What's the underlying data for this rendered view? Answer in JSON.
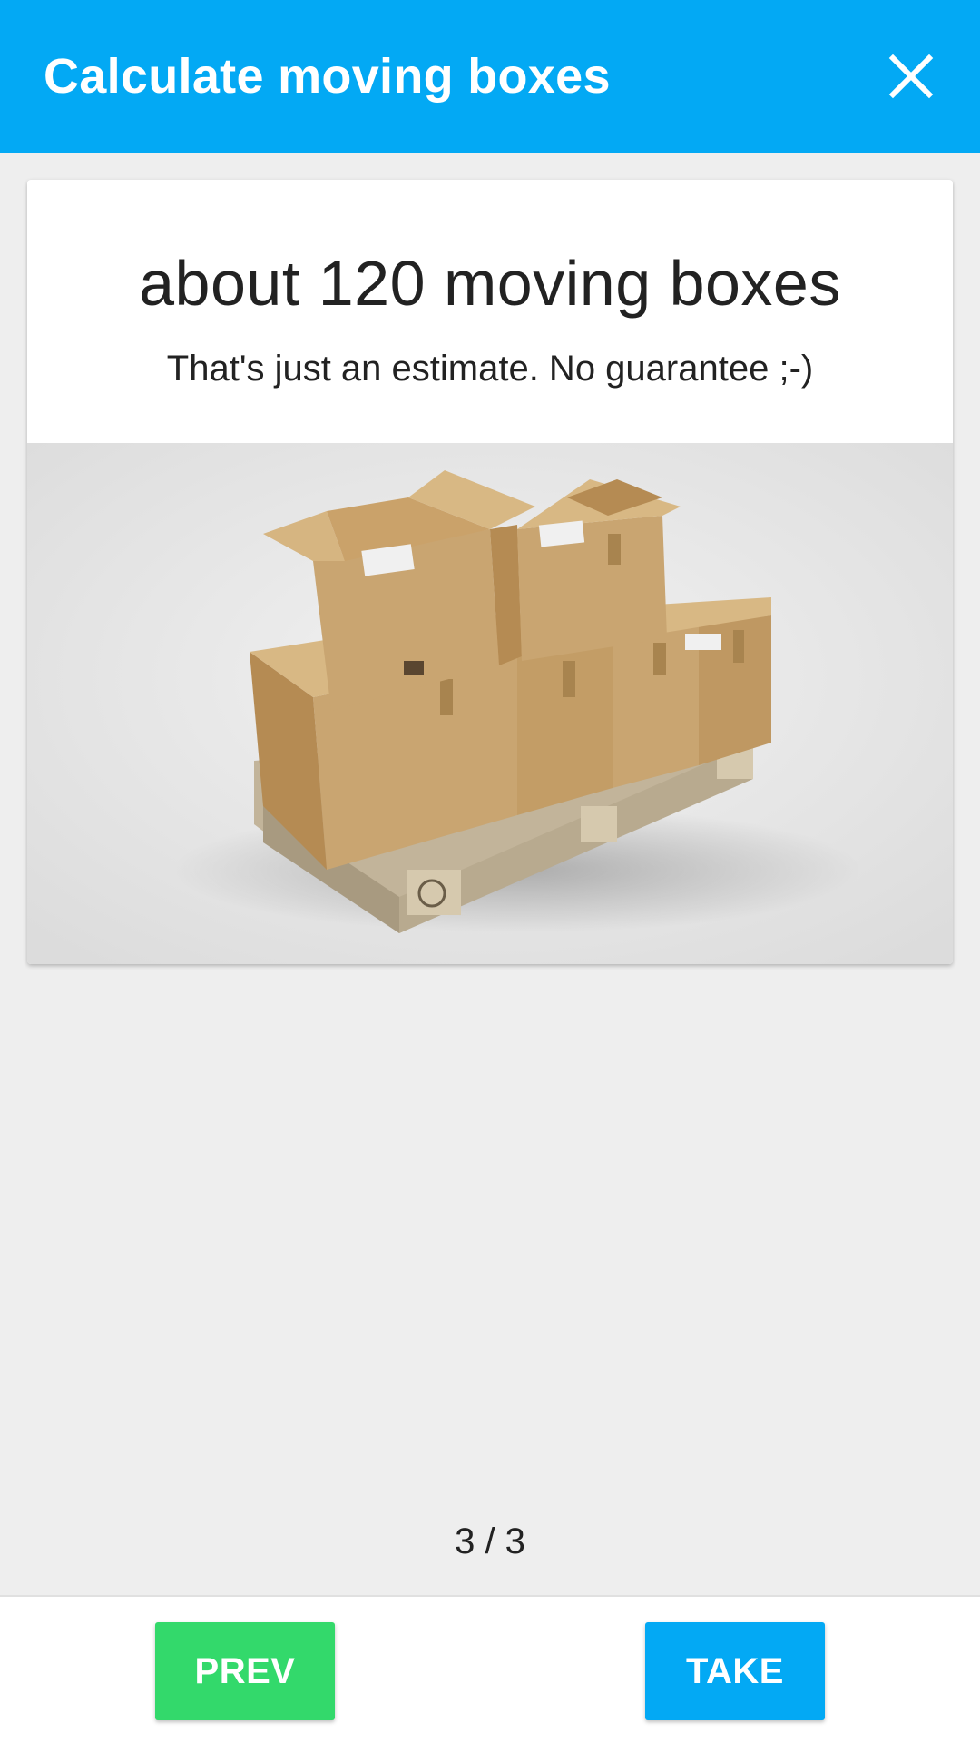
{
  "app_bar": {
    "title": "Calculate moving boxes",
    "close_icon": "close-icon"
  },
  "result": {
    "title": "about 120 moving boxes",
    "subtitle": "That's just an estimate. No guarantee ;-)",
    "image_icon": "moving-boxes-on-pallet-image"
  },
  "pager": {
    "text": "3 / 3"
  },
  "actions": {
    "prev_label": "PREV",
    "take_label": "TAKE"
  },
  "colors": {
    "primary": "#03a9f4",
    "prev_button": "#33d96b",
    "background": "#eeeeee"
  }
}
